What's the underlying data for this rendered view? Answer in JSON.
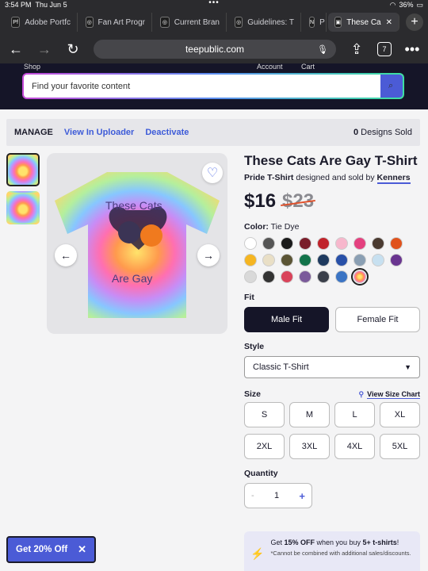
{
  "status": {
    "time": "3:54 PM",
    "date": "Thu Jun 5",
    "battery": "36%"
  },
  "tabs": [
    {
      "label": "Adobe Portfc",
      "icon": "Pf"
    },
    {
      "label": "Fan Art Progr",
      "icon": "◎"
    },
    {
      "label": "Current Bran",
      "icon": "◎"
    },
    {
      "label": "Guidelines: T",
      "icon": "◎"
    },
    {
      "label": "P",
      "icon": "N"
    },
    {
      "label": "These Ca",
      "icon": "▣"
    }
  ],
  "browser": {
    "url": "teepublic.com",
    "tab_count": "7",
    "back": "←",
    "forward": "→",
    "reload": "↻",
    "share": "⇪",
    "more": "•••",
    "new_tab": "+",
    "close_tab": "✕",
    "mic": "🎙"
  },
  "site": {
    "nav_shop": "Shop",
    "nav_account": "Account",
    "nav_cart": "Cart",
    "search_placeholder": "Find your favorite content"
  },
  "manage": {
    "label": "MANAGE",
    "link1": "View In Uploader",
    "link2": "Deactivate",
    "count": "0",
    "count_label": "Designs Sold"
  },
  "product": {
    "title": "These Cats Are Gay T-Shirt",
    "type": "Pride T-Shirt",
    "by_text": "designed and sold by",
    "artist": "Kenners",
    "price": "$16",
    "old_price": "$23",
    "color_label": "Color:",
    "color_value": "Tie Dye",
    "shirt_text_top": "These Cats",
    "shirt_text_bottom": "Are Gay"
  },
  "swatches": [
    "#ffffff",
    "#555555",
    "#1a1a1a",
    "#7a1d2a",
    "#c0232b",
    "#f7b7cc",
    "#e4417f",
    "#4a3a30",
    "#e0521c",
    "#f5b521",
    "#e9dfc6",
    "#5b5535",
    "#12734a",
    "#1e3a5f",
    "#2850a8",
    "#8a9fb3",
    "#c7e0f0",
    "#6a3590",
    "#d9d9d9",
    "#333333",
    "#d9435a",
    "#7a5a9a",
    "#3a3f4a",
    "#3b74c4",
    "#f2a860"
  ],
  "fit": {
    "label": "Fit",
    "male": "Male Fit",
    "female": "Female Fit"
  },
  "style": {
    "label": "Style",
    "value": "Classic T-Shirt"
  },
  "size": {
    "label": "Size",
    "chart": "View Size Chart",
    "options": [
      "S",
      "M",
      "L",
      "XL",
      "2XL",
      "3XL",
      "4XL",
      "5XL"
    ]
  },
  "quantity": {
    "label": "Quantity",
    "value": "1",
    "minus": "-",
    "plus": "+"
  },
  "promo": {
    "pre": "Get ",
    "bold1": "15% OFF",
    "mid": " when you buy ",
    "bold2": "5+ t-shirts",
    "post": "!",
    "note": "*Cannot be combined with additional sales/discounts."
  },
  "getoff": {
    "label": "Get 20% Off"
  },
  "colors": {
    "accent": "#4b5bd6",
    "navy": "#151528"
  }
}
